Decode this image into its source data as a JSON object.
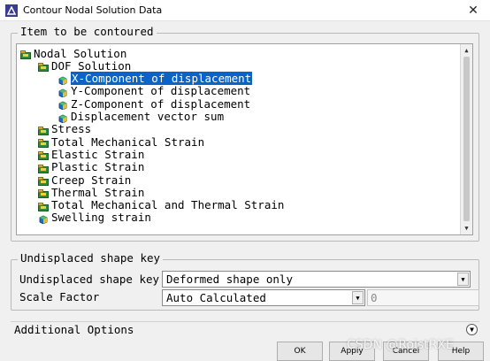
{
  "window": {
    "title": "Contour Nodal Solution Data",
    "close": "✕"
  },
  "group_item": {
    "label": "Item to be contoured"
  },
  "tree": [
    {
      "label": "Nodal Solution",
      "selected": false,
      "icon": "folder-icon"
    },
    {
      "label": "DOF Solution",
      "selected": false,
      "icon": "folder-icon"
    },
    {
      "label": "X-Component of displacement",
      "selected": true,
      "icon": "cube-icon"
    },
    {
      "label": "Y-Component of displacement",
      "selected": false,
      "icon": "cube-icon"
    },
    {
      "label": "Z-Component of displacement",
      "selected": false,
      "icon": "cube-icon"
    },
    {
      "label": "Displacement vector sum",
      "selected": false,
      "icon": "cube-icon"
    },
    {
      "label": "Stress",
      "selected": false,
      "icon": "folder-icon"
    },
    {
      "label": "Total Mechanical Strain",
      "selected": false,
      "icon": "folder-icon"
    },
    {
      "label": "Elastic Strain",
      "selected": false,
      "icon": "folder-icon"
    },
    {
      "label": "Plastic Strain",
      "selected": false,
      "icon": "folder-icon"
    },
    {
      "label": "Creep Strain",
      "selected": false,
      "icon": "folder-icon"
    },
    {
      "label": "Thermal Strain",
      "selected": false,
      "icon": "folder-icon"
    },
    {
      "label": "Total Mechanical and Thermal Strain",
      "selected": false,
      "icon": "folder-icon"
    },
    {
      "label": "Swelling strain",
      "selected": false,
      "icon": "cube-icon"
    }
  ],
  "group_shape": {
    "label": "Undisplaced shape key"
  },
  "shape_key": {
    "label": "Undisplaced shape key",
    "value": "Deformed shape only"
  },
  "scale": {
    "label": "Scale Factor",
    "value": "Auto Calculated",
    "input": "0"
  },
  "additional": {
    "label": "Additional Options"
  },
  "buttons": {
    "ok": "OK",
    "apply": "Apply",
    "cancel": "Cancel",
    "help": "Help"
  },
  "watermark": "CSDN @RoistRXE",
  "colors": {
    "selection": "#0a64c8",
    "folder_icon": "#2e8b3a",
    "cube_icon": "#1e6fbf"
  }
}
